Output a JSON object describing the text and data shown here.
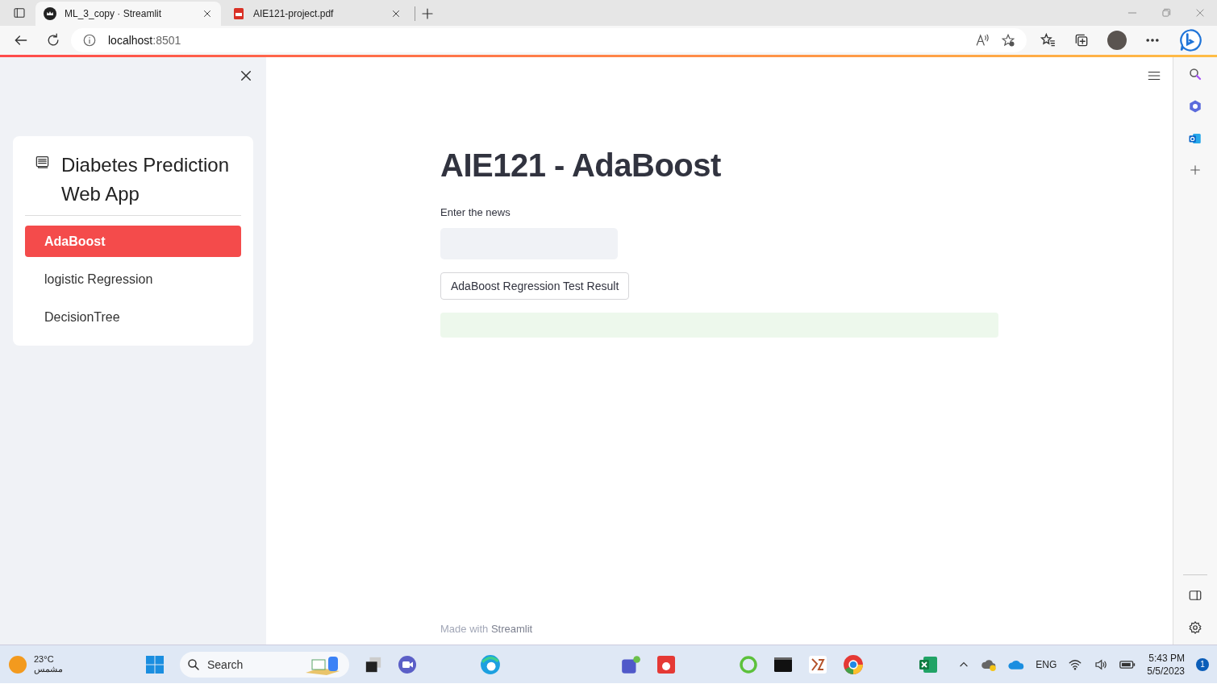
{
  "browser": {
    "tabs": [
      {
        "title": "ML_3_copy · Streamlit",
        "selected": true,
        "kind": "app"
      },
      {
        "title": "AIE121-project.pdf",
        "selected": false,
        "kind": "pdf"
      }
    ],
    "address": {
      "host": "localhost",
      "port": ":8501"
    }
  },
  "sidebar": {
    "title": "Diabetes Prediction Web App",
    "menu": [
      {
        "label": "AdaBoost",
        "selected": true
      },
      {
        "label": "logistic Regression",
        "selected": false
      },
      {
        "label": "DecisionTree",
        "selected": false
      }
    ]
  },
  "main": {
    "title": "AIE121 - AdaBoost",
    "input_label": "Enter the news",
    "button": "AdaBoost Regression Test Result",
    "footer": {
      "text": "Made with",
      "link": "Streamlit"
    }
  },
  "taskbar": {
    "weather": {
      "temp": "23°C",
      "condition": "مشمس"
    },
    "search": "Search",
    "tray": {
      "language": "ENG",
      "time": "5:43 PM",
      "date": "5/5/2023",
      "notifications": "1"
    }
  }
}
